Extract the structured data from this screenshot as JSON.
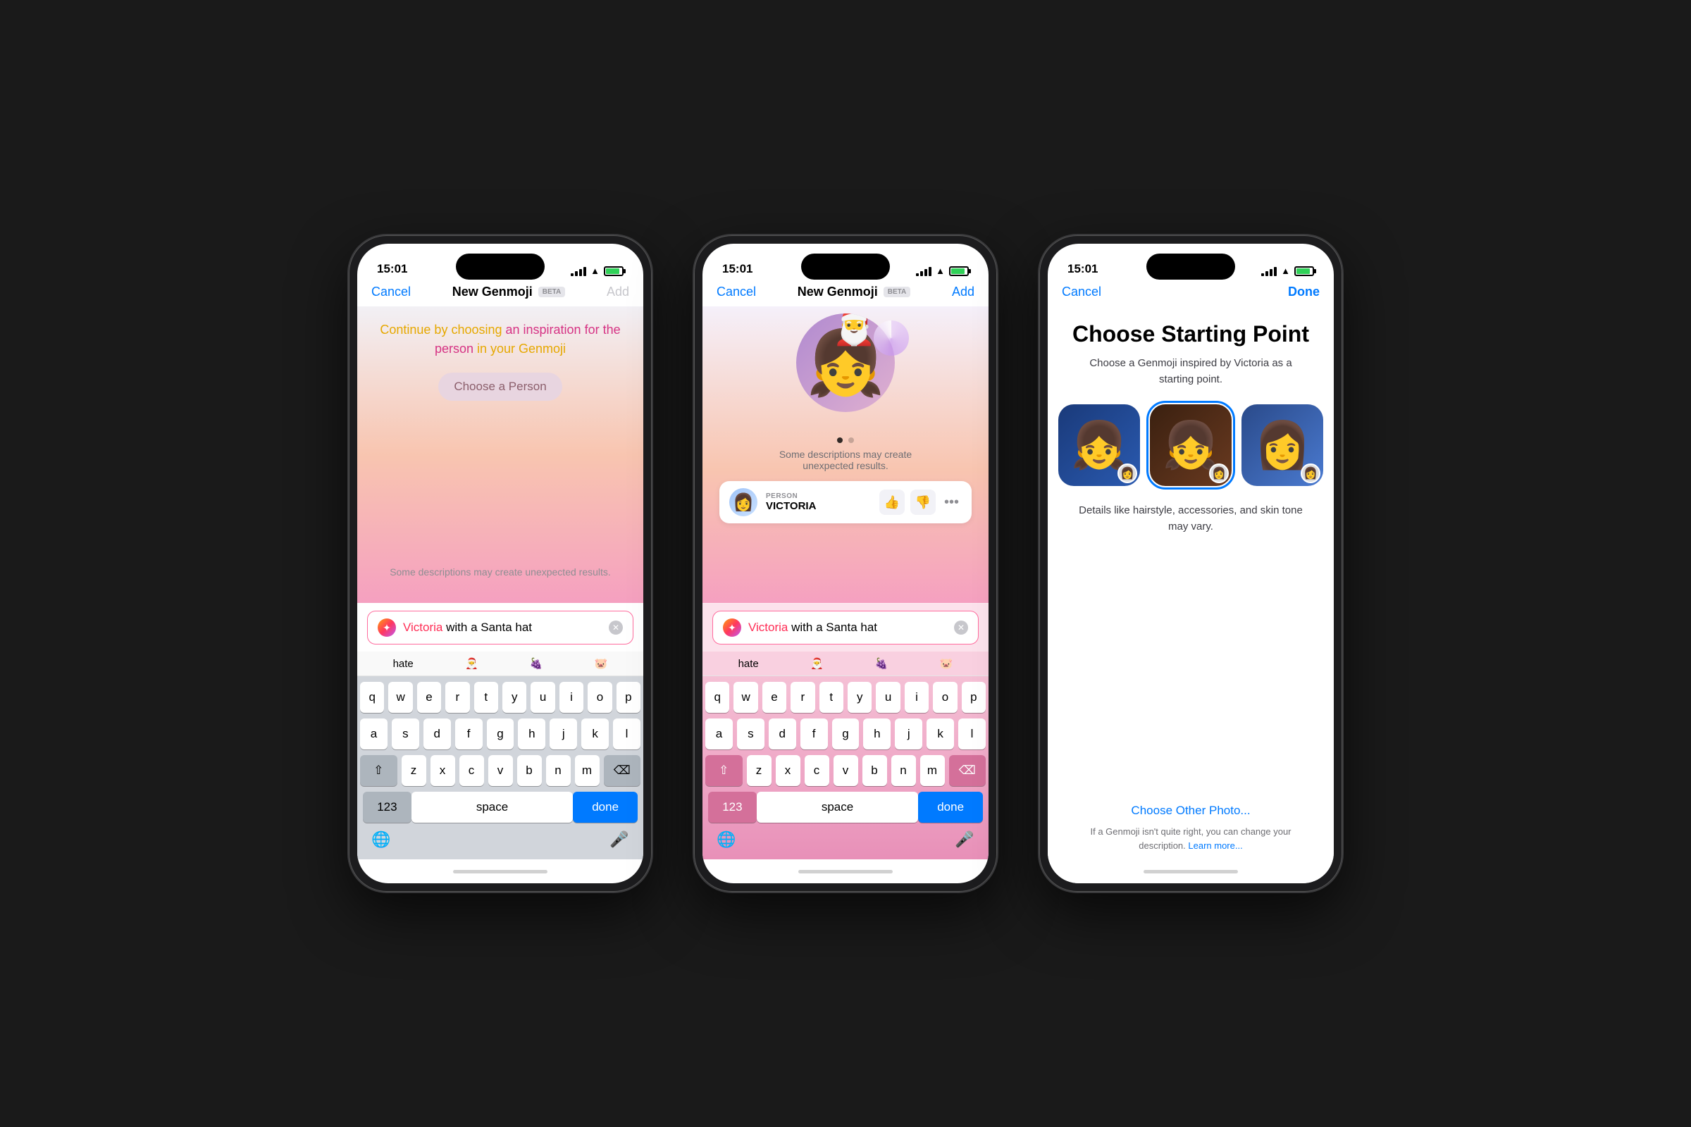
{
  "colors": {
    "blue": "#007aff",
    "red": "#ff2d55",
    "green": "#30d158",
    "gray": "#8e8e93",
    "darkGray": "#3c3c43",
    "keyboard_pink_top": "#f5c0d5",
    "keyboard_pink_bottom": "#e890b8"
  },
  "phone1": {
    "status_time": "15:01",
    "nav_cancel": "Cancel",
    "nav_title": "New Genmoji",
    "nav_badge": "BETA",
    "nav_add": "Add",
    "inspiration_text_1": "Continue by choosing an inspiration for the",
    "inspiration_text_2": "person in your Genmoji",
    "choose_person_btn": "Choose a Person",
    "unexpected_text": "Some descriptions may create unexpected results.",
    "search_placeholder": "Victoria with a Santa hat",
    "search_highlight": "Victoria",
    "autocomplete_1": "hate",
    "autocomplete_emoji_1": "🎅",
    "autocomplete_emoji_2": "🍇",
    "autocomplete_emoji_3": "🐷",
    "keyboard_rows": [
      [
        "q",
        "w",
        "e",
        "r",
        "t",
        "y",
        "u",
        "i",
        "o",
        "p"
      ],
      [
        "a",
        "s",
        "d",
        "f",
        "g",
        "h",
        "j",
        "k",
        "l"
      ],
      [
        "⇧",
        "z",
        "x",
        "c",
        "v",
        "b",
        "n",
        "m",
        "⌫"
      ],
      [
        "123",
        "space",
        "done"
      ]
    ]
  },
  "phone2": {
    "status_time": "15:01",
    "nav_cancel": "Cancel",
    "nav_title": "New Genmoji",
    "nav_badge": "BETA",
    "nav_add": "Add",
    "unexpected_text": "Some descriptions may create\nunexpected results.",
    "person_label": "PERSON",
    "person_name": "VICTORIA",
    "search_placeholder": "Victoria with a Santa hat",
    "search_highlight": "Victoria"
  },
  "phone3": {
    "status_time": "15:01",
    "nav_cancel": "Cancel",
    "nav_done": "Done",
    "title": "Choose Starting Point",
    "subtitle": "Choose a Genmoji inspired by Victoria as a starting point.",
    "details_text": "Details like hairstyle, accessories, and skin tone may vary.",
    "choose_other_btn": "Choose Other Photo...",
    "learn_more_text": "If a Genmoji isn't quite right, you can change your description.",
    "learn_more_link": "Learn more..."
  }
}
